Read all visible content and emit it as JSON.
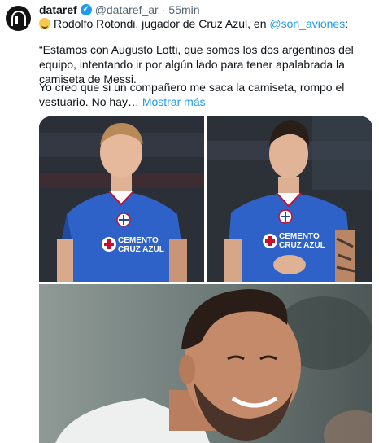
{
  "tweet": {
    "author_name": "dataref",
    "author_handle": "@dataref_ar",
    "separator": "·",
    "time": "55min",
    "line1_text": "Rodolfo Rotondi, jugador de Cruz Azul, en ",
    "line1_link": "@son_aviones",
    "line1_end": ":",
    "paragraph1": "“Estamos con Augusto Lotti, que somos los dos argentinos del equipo, intentando ir por algún lado para tener apalabrada la camiseta de Messi.",
    "paragraph2": "Yo creo que si un compañero me saca la camiseta, rompo el vestuario. No hay…",
    "show_more": "Mostrar más"
  },
  "jersey": {
    "sponsor_line1": "CEMENTO",
    "sponsor_line2": "CRUZ AZUL"
  },
  "colors": {
    "link": "#1d9bf0",
    "verified": "#1d9bf0",
    "jersey_blue": "#2f62c8"
  },
  "icons": {
    "avatar": "dataref-logo",
    "verified": "verified-badge-icon",
    "emoji": "grinning-sweat-emoji"
  }
}
